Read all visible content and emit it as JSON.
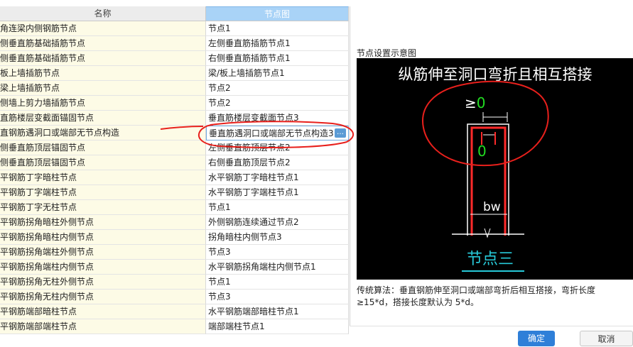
{
  "table": {
    "columns": {
      "name": "名称",
      "node": "节点图"
    },
    "rows": [
      {
        "name": "角连梁内侧钢筋节点",
        "node": "节点1"
      },
      {
        "name": "侧垂直筋基础插筋节点",
        "node": "左侧垂直筋插筋节点1"
      },
      {
        "name": "侧垂直筋基础插筋节点",
        "node": "右侧垂直筋插筋节点1"
      },
      {
        "name": "板上墙插筋节点",
        "node": "梁/板上墙插筋节点1"
      },
      {
        "name": "梁上墙插筋节点",
        "node": "节点2"
      },
      {
        "name": "侧墙上剪力墙插筋节点",
        "node": "节点2"
      },
      {
        "name": "直筋楼层变截面锚固节点",
        "node": "垂直筋楼层变截面节点3"
      },
      {
        "name": "直钢筋遇洞口或端部无节点构造",
        "node": "垂直筋遇洞口或端部无节点构造3",
        "selected": true
      },
      {
        "name": "侧垂直筋顶层锚固节点",
        "node": "左侧垂直筋顶层节点2"
      },
      {
        "name": "侧垂直筋顶层锚固节点",
        "node": "右侧垂直筋顶层节点2"
      },
      {
        "name": "平钢筋丁字暗柱节点",
        "node": "水平钢筋丁字暗柱节点1"
      },
      {
        "name": "平钢筋丁字端柱节点",
        "node": "水平钢筋丁字端柱节点1"
      },
      {
        "name": "平钢筋丁字无柱节点",
        "node": "节点1"
      },
      {
        "name": "平钢筋拐角暗柱外侧节点",
        "node": "外侧钢筋连续通过节点2"
      },
      {
        "name": "平钢筋拐角暗柱内侧节点",
        "node": "拐角暗柱内侧节点3"
      },
      {
        "name": "平钢筋拐角端柱外侧节点",
        "node": "节点3"
      },
      {
        "name": "平钢筋拐角端柱内侧节点",
        "node": "水平钢筋拐角端柱内侧节点1"
      },
      {
        "name": "平钢筋拐角无柱外侧节点",
        "node": "节点1"
      },
      {
        "name": "平钢筋拐角无柱内侧节点",
        "node": "节点3"
      },
      {
        "name": "平钢筋端部暗柱节点",
        "node": "水平钢筋端部暗柱节点1"
      },
      {
        "name": "平钢筋端部端柱节点",
        "node": "端部端柱节点1"
      }
    ]
  },
  "more_button": "…",
  "preview": {
    "label": "节点设置示意图",
    "title": "纵筋伸至洞口弯折且相互搭接",
    "dim_ge": "≥0",
    "dim_zero": "0",
    "dim_bw": "bw",
    "caption": "节点三"
  },
  "description": "传统算法：垂直钢筋伸至洞口或端部弯折后相互搭接，弯折长度≥15*d，搭接长度默认为 5*d。",
  "buttons": {
    "ok": "确定",
    "cancel": "取消"
  },
  "colors": {
    "header_accent": "#a9d3f7",
    "name_cell_bg": "#fdfbe6",
    "annotation_red": "#e8201c",
    "caption_cyan": "#27c9d8"
  }
}
